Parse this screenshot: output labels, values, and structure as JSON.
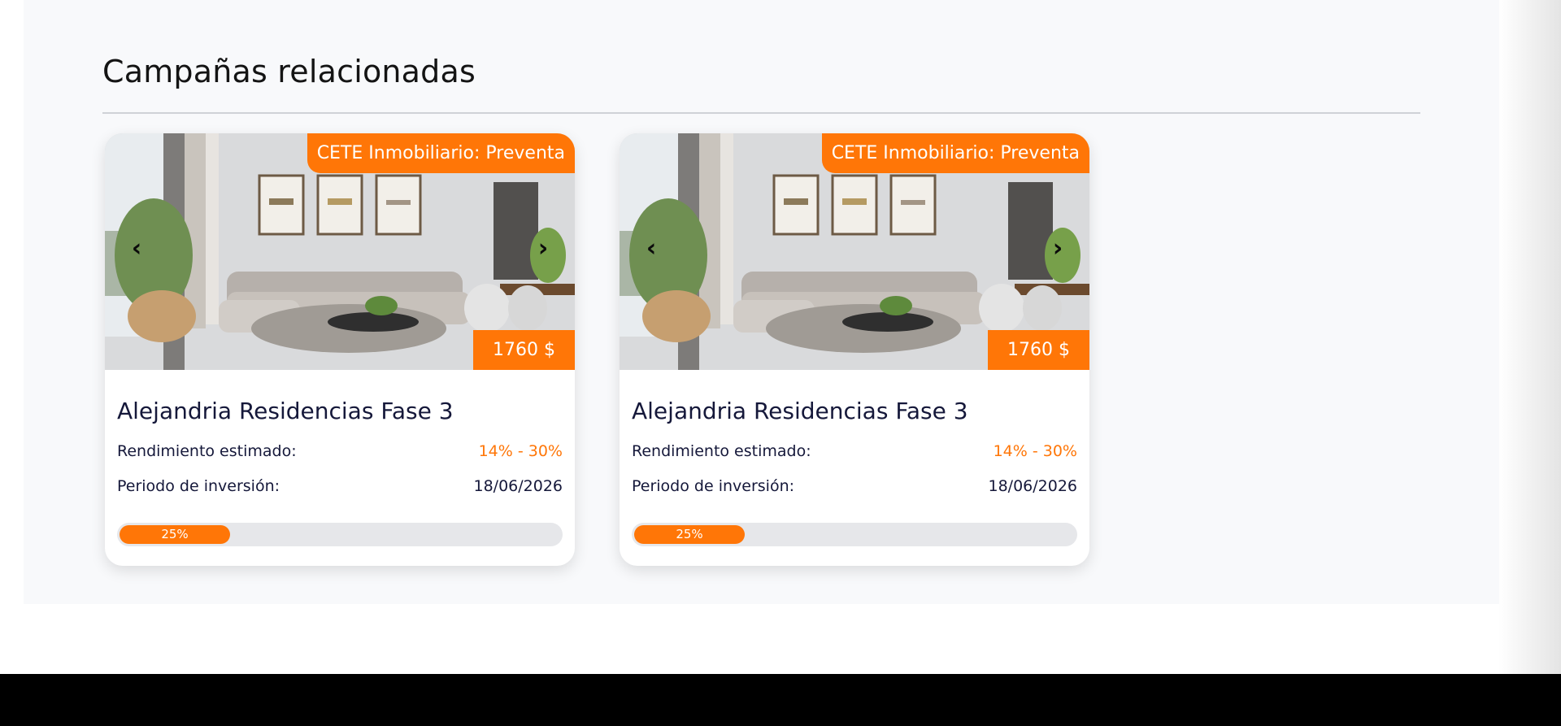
{
  "section": {
    "title": "Campañas relacionadas"
  },
  "cards": [
    {
      "tag": "CETE Inmobiliario: Preventa",
      "price": "1760 $",
      "name": "Alejandria Residencias Fase 3",
      "yield_label": "Rendimiento estimado:",
      "yield_value": "14% - 30%",
      "period_label": "Periodo de inversión:",
      "period_value": "18/06/2026",
      "progress_label": "25%",
      "progress": 0.25
    },
    {
      "tag": "CETE Inmobiliario: Preventa",
      "price": "1760 $",
      "name": "Alejandria Residencias Fase 3",
      "yield_label": "Rendimiento estimado:",
      "yield_value": "14% - 30%",
      "period_label": "Periodo de inversión:",
      "period_value": "18/06/2026",
      "progress_label": "25%",
      "progress": 0.25
    }
  ],
  "icons": {
    "prev": "chevron-left-icon",
    "next": "chevron-right-icon"
  },
  "colors": {
    "accent": "#ff7607",
    "text_dark": "#15183a",
    "section_bg": "#f8f9fb",
    "footer_bg": "#000000"
  }
}
